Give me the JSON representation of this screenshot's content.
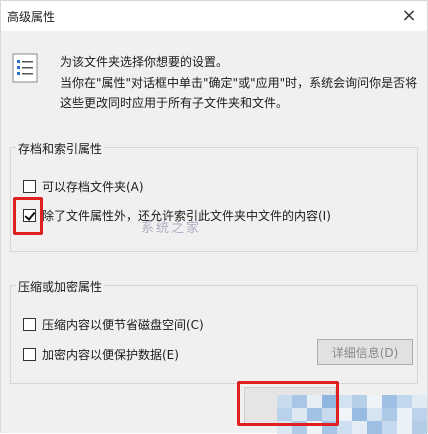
{
  "window": {
    "title": "高级属性",
    "close_glyph": "×"
  },
  "intro": {
    "line1": "为该文件夹选择你想要的设置。",
    "line2": "当你在\"属性\"对话框中单击\"确定\"或\"应用\"时，系统会询问你是否将这些更改同时应用于所有子文件夹和文件。"
  },
  "archive_group": {
    "title": "存档和索引属性",
    "items": [
      {
        "label": "可以存档文件夹(A)",
        "checked": false
      },
      {
        "label": "除了文件属性外，还允许索引此文件夹中文件的内容(I)",
        "checked": true
      }
    ]
  },
  "compress_group": {
    "title": "压缩或加密属性",
    "items": [
      {
        "label": "压缩内容以便节省磁盘空间(C)",
        "checked": false
      },
      {
        "label": "加密内容以便保护数据(E)",
        "checked": false
      }
    ],
    "details_button": "详细信息(D)"
  },
  "watermark": "系统之家",
  "colors": {
    "highlight_red": "#e02020",
    "body_bg": "#f0f0f0"
  }
}
